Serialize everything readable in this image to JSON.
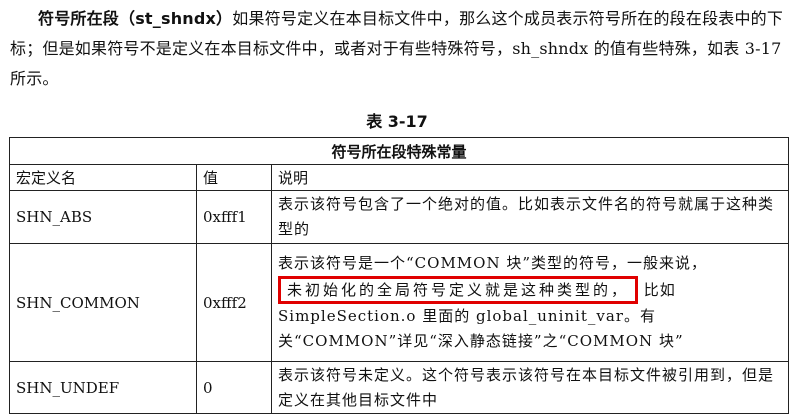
{
  "paragraph": {
    "term": "符号所在段（st_shndx）",
    "text": "如果符号定义在本目标文件中，那么这个成员表示符号所在的段在段表中的下标；但是如果符号不是定义在本目标文件中，或者对于有些特殊符号，sh_shndx 的值有些特殊，如表 3-17 所示。"
  },
  "caption": "表 3-17",
  "table": {
    "title": "符号所在段特殊常量",
    "headers": [
      "宏定义名",
      "值",
      "说明"
    ],
    "rows": [
      {
        "name": "SHN_ABS",
        "value": "0xfff1",
        "desc": "表示该符号包含了一个绝对的值。比如表示文件名的符号就属于这种类型的"
      },
      {
        "name": "SHN_COMMON",
        "value": "0xfff2",
        "desc_before": "表示该符号是一个“COMMON 块”类型的符号，一般来说，",
        "desc_highlight": "未初始化的全局符号定义就是这种类型的，",
        "desc_after": "比如 SimpleSection.o 里面的 global_uninit_var。有关“COMMON”详见“深入静态链接”之“COMMON 块”"
      },
      {
        "name": "SHN_UNDEF",
        "value": "0",
        "desc": "表示该符号未定义。这个符号表示该符号在本目标文件被引用到，但是定义在其他目标文件中"
      }
    ]
  },
  "highlight_color": "#e00000"
}
